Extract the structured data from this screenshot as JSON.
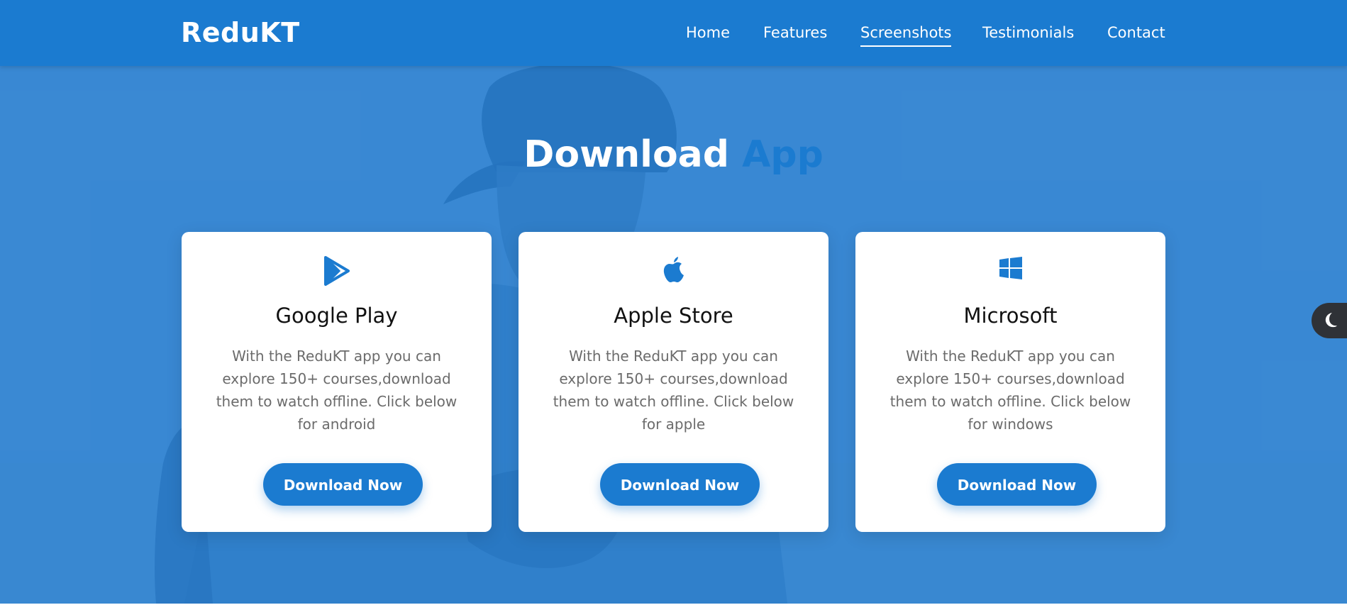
{
  "brand": {
    "name": "ReduKT"
  },
  "nav": {
    "items": [
      {
        "label": "Home"
      },
      {
        "label": "Features"
      },
      {
        "label": "Screenshots",
        "active": true
      },
      {
        "label": "Testimonials"
      },
      {
        "label": "Contact"
      }
    ]
  },
  "hero": {
    "title_main": "Download",
    "title_accent": "App"
  },
  "cards": [
    {
      "icon": "google-play-icon",
      "title": "Google Play",
      "text": "With the ReduKT app you can explore 150+ courses,download them to watch offline. Click below for android",
      "button": "Download Now"
    },
    {
      "icon": "apple-icon",
      "title": "Apple Store",
      "text": "With the ReduKT app you can explore 150+ courses,download them to watch offline. Click below for apple",
      "button": "Download Now"
    },
    {
      "icon": "windows-icon",
      "title": "Microsoft",
      "text": "With the ReduKT app you can explore 150+ courses,download them to watch offline. Click below for windows",
      "button": "Download Now"
    }
  ],
  "theme_toggle": {
    "icon": "moon-icon"
  },
  "colors": {
    "primary": "#1b7bd0",
    "hero_bg": "#4a90d4",
    "toggle_bg": "#2f3237"
  }
}
